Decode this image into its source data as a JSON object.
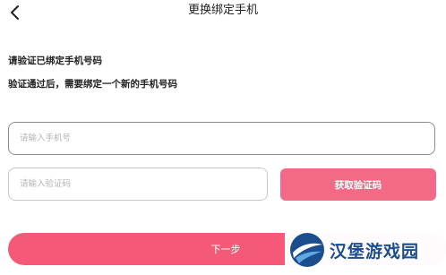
{
  "nav": {
    "back_icon": "chevron-left-icon",
    "title": "更换绑定手机"
  },
  "hints": {
    "line1": "请验证已绑定手机号码",
    "line2": "验证通过后，需要绑定一个新的手机号码"
  },
  "form": {
    "phone_placeholder": "请输入手机号",
    "phone_value": "",
    "code_placeholder": "请输入验证码",
    "code_value": "",
    "get_code_label": "获取验证码",
    "next_label": "下一步"
  },
  "watermark": {
    "text": "汉堡游戏园",
    "logo_icon": "swoosh-logo-icon"
  },
  "colors": {
    "accent_button": "#f36a86",
    "primary_button": "#f45a78",
    "watermark_text": "#1b4e8c"
  }
}
